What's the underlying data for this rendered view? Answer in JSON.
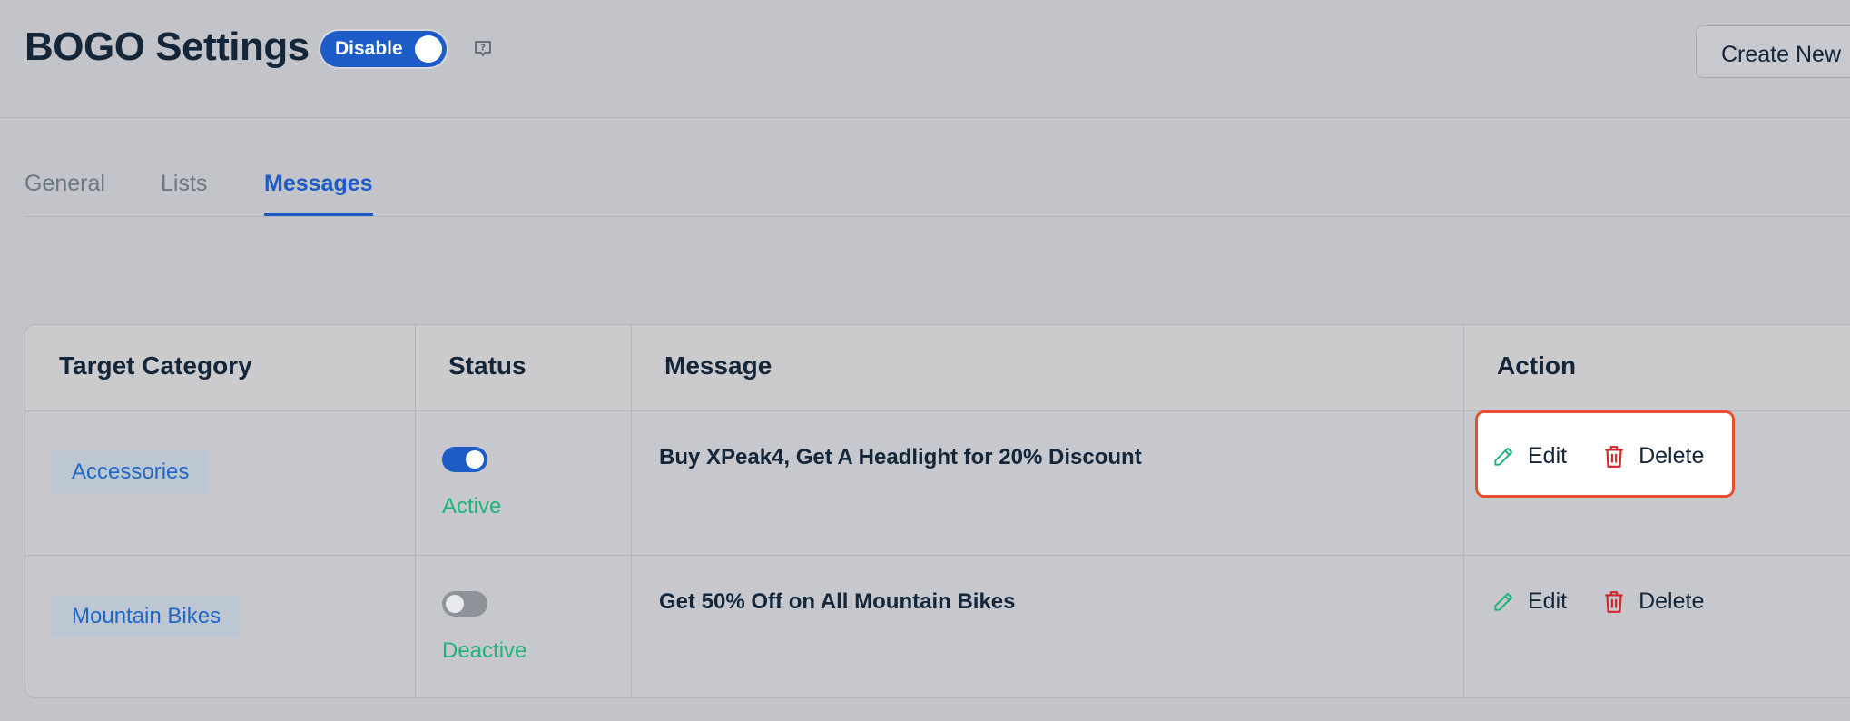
{
  "header": {
    "title": "BOGO Settings",
    "toggle_label": "Disable",
    "create_button": "Create New"
  },
  "tabs": [
    {
      "label": "General"
    },
    {
      "label": "Lists"
    },
    {
      "label": "Messages"
    }
  ],
  "active_tab": "Messages",
  "table": {
    "columns": [
      "Target Category",
      "Status",
      "Message",
      "Action"
    ],
    "rows": [
      {
        "category": "Accessories",
        "enabled": true,
        "status": "Active",
        "message": "Buy XPeak4, Get A Headlight for 20% Discount",
        "edit": "Edit",
        "delete": "Delete"
      },
      {
        "category": "Mountain Bikes",
        "enabled": false,
        "status": "Deactive",
        "message": "Get 50% Off on All Mountain Bikes",
        "edit": "Edit",
        "delete": "Delete"
      }
    ]
  },
  "colors": {
    "accent": "#1d5cc6",
    "active_status": "#22b27a",
    "delete_icon": "#d0262a",
    "edit_icon": "#22b27a",
    "highlight_border": "#e6502f"
  },
  "icons": [
    "help-icon",
    "pencil-icon",
    "trash-icon"
  ]
}
